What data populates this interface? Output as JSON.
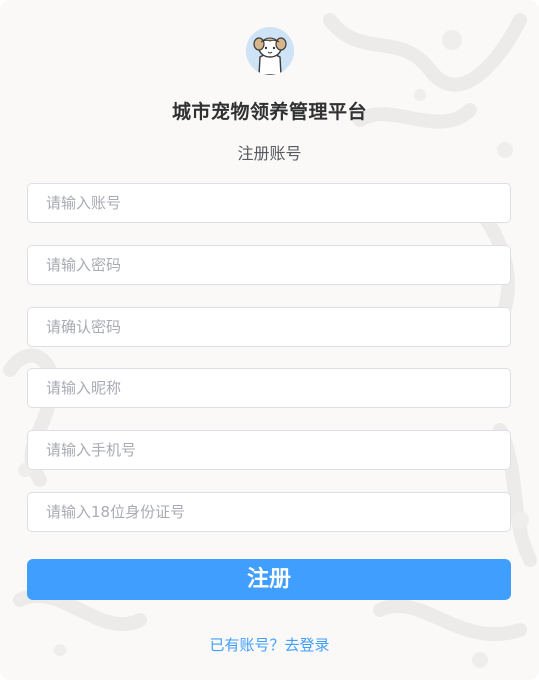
{
  "app": {
    "title": "城市宠物领养管理平台",
    "subtitle": "注册账号"
  },
  "form": {
    "fields": [
      {
        "placeholder": "请输入账号",
        "value": ""
      },
      {
        "placeholder": "请输入密码",
        "value": ""
      },
      {
        "placeholder": "请确认密码",
        "value": ""
      },
      {
        "placeholder": "请输入昵称",
        "value": ""
      },
      {
        "placeholder": "请输入手机号",
        "value": ""
      },
      {
        "placeholder": "请输入18位身份证号",
        "value": ""
      }
    ],
    "submit_label": "注册",
    "login_link": "已有账号？去登录"
  },
  "colors": {
    "accent": "#409eff",
    "background": "#faf9f7",
    "border": "#dcdfe6",
    "placeholder": "#a8abb2",
    "title": "#303133"
  },
  "icons": {
    "logo": "puppy-avatar-icon"
  }
}
